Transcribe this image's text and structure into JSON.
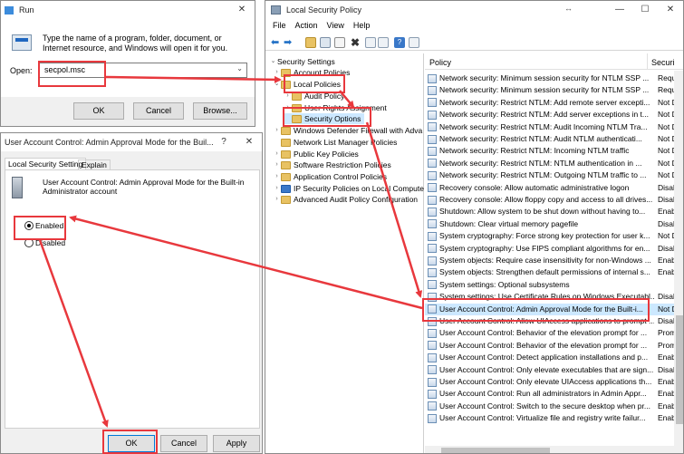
{
  "run": {
    "title": "Run",
    "description": "Type the name of a program, folder, document, or Internet resource, and Windows will open it for you.",
    "open_label": "Open:",
    "open_value": "secpol.msc",
    "ok": "OK",
    "cancel": "Cancel",
    "browse": "Browse..."
  },
  "lsp": {
    "title": "Local Security Policy",
    "menu": [
      "File",
      "Action",
      "View",
      "Help"
    ],
    "tree": [
      {
        "label": "Security Settings",
        "level": 0,
        "arrow": "⌄"
      },
      {
        "label": "Account Policies",
        "level": 1,
        "arrow": "›"
      },
      {
        "label": "Local Policies",
        "level": 1,
        "arrow": "⌄"
      },
      {
        "label": "Audit Policy",
        "level": 2,
        "arrow": "›"
      },
      {
        "label": "User Rights Assignment",
        "level": 2,
        "arrow": "›"
      },
      {
        "label": "Security Options",
        "level": 2,
        "arrow": ""
      },
      {
        "label": "Windows Defender Firewall with Adva",
        "level": 1,
        "arrow": "›"
      },
      {
        "label": "Network List Manager Policies",
        "level": 1,
        "arrow": ""
      },
      {
        "label": "Public Key Policies",
        "level": 1,
        "arrow": "›"
      },
      {
        "label": "Software Restriction Policies",
        "level": 1,
        "arrow": "›"
      },
      {
        "label": "Application Control Policies",
        "level": 1,
        "arrow": "›"
      },
      {
        "label": "IP Security Policies on Local Compute",
        "level": 1,
        "arrow": "›"
      },
      {
        "label": "Advanced Audit Policy Configuration",
        "level": 1,
        "arrow": "›"
      }
    ],
    "col_policy": "Policy",
    "col_security": "Securi",
    "policies": [
      {
        "name": "Network security: Minimum session security for NTLM SSP ...",
        "setting": "Requi"
      },
      {
        "name": "Network security: Minimum session security for NTLM SSP ...",
        "setting": "Requi"
      },
      {
        "name": "Network security: Restrict NTLM: Add remote server excepti...",
        "setting": "Not D"
      },
      {
        "name": "Network security: Restrict NTLM: Add server exceptions in t...",
        "setting": "Not D"
      },
      {
        "name": "Network security: Restrict NTLM: Audit Incoming NTLM Tra...",
        "setting": "Not D"
      },
      {
        "name": "Network security: Restrict NTLM: Audit NTLM authenticati...",
        "setting": "Not D"
      },
      {
        "name": "Network security: Restrict NTLM: Incoming NTLM traffic",
        "setting": "Not D"
      },
      {
        "name": "Network security: Restrict NTLM: NTLM authentication in ...",
        "setting": "Not D"
      },
      {
        "name": "Network security: Restrict NTLM: Outgoing NTLM traffic to ...",
        "setting": "Not D"
      },
      {
        "name": "Recovery console: Allow automatic administrative logon",
        "setting": "Disab"
      },
      {
        "name": "Recovery console: Allow floppy copy and access to all drives...",
        "setting": "Disab"
      },
      {
        "name": "Shutdown: Allow system to be shut down without having to...",
        "setting": "Enabl"
      },
      {
        "name": "Shutdown: Clear virtual memory pagefile",
        "setting": "Disab"
      },
      {
        "name": "System cryptography: Force strong key protection for user k...",
        "setting": "Not D"
      },
      {
        "name": "System cryptography: Use FIPS compliant algorithms for en...",
        "setting": "Disab"
      },
      {
        "name": "System objects: Require case insensitivity for non-Windows ...",
        "setting": "Enabl"
      },
      {
        "name": "System objects: Strengthen default permissions of internal s...",
        "setting": "Enabl"
      },
      {
        "name": "System settings: Optional subsystems",
        "setting": ""
      },
      {
        "name": "System settings: Use Certificate Rules on Windows Executabl...",
        "setting": "Disab"
      },
      {
        "name": "User Account Control: Admin Approval Mode for the Built-i...",
        "setting": "Not D"
      },
      {
        "name": "User Account Control: Allow UIAccess applications to prompt ...",
        "setting": "Disab"
      },
      {
        "name": "User Account Control: Behavior of the elevation prompt for ...",
        "setting": "Promp"
      },
      {
        "name": "User Account Control: Behavior of the elevation prompt for ...",
        "setting": "Promp"
      },
      {
        "name": "User Account Control: Detect application installations and p...",
        "setting": "Enabl"
      },
      {
        "name": "User Account Control: Only elevate executables that are sign...",
        "setting": "Disab"
      },
      {
        "name": "User Account Control: Only elevate UIAccess applications th...",
        "setting": "Enabl"
      },
      {
        "name": "User Account Control: Run all administrators in Admin Appr...",
        "setting": "Enabl"
      },
      {
        "name": "User Account Control: Switch to the secure desktop when pr...",
        "setting": "Enabl"
      },
      {
        "name": "User Account Control: Virtualize file and registry write failur...",
        "setting": "Enabl"
      }
    ]
  },
  "uac": {
    "title": "User Account Control: Admin Approval Mode for the Buil...",
    "help": "?",
    "tab_local": "Local Security Setting",
    "tab_explain": "Explain",
    "description": "User Account Control: Admin Approval Mode for the Built-in Administrator account",
    "enabled": "Enabled",
    "disabled": "Disabled",
    "ok": "OK",
    "cancel": "Cancel",
    "apply": "Apply"
  },
  "colors": {
    "highlight": "#e8383d",
    "selection": "#cce8ff",
    "focus": "#0078d7"
  }
}
